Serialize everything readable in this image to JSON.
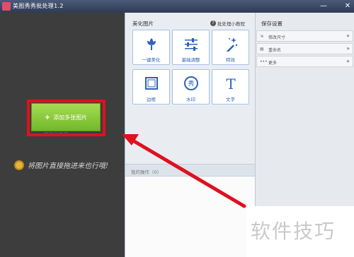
{
  "window": {
    "title": "美图秀秀批处理1.2",
    "minimize": "—",
    "close": "✕"
  },
  "left": {
    "add_button": "添加多张图片",
    "add_plus": "+",
    "under_text": "添加文件夹",
    "hint": "将图片直接拖进来也行哦!"
  },
  "beautify": {
    "title": "美化图片",
    "tutorial": "批处理小教程",
    "tutorial_icon": "?",
    "tools": [
      {
        "label": "一键美化",
        "icon": "flower-icon"
      },
      {
        "label": "基础调整",
        "icon": "sliders-icon"
      },
      {
        "label": "特效",
        "icon": "magic-wand-icon"
      },
      {
        "label": "边框",
        "icon": "frame-icon"
      },
      {
        "label": "水印",
        "icon": "watermark-icon",
        "glyph": "秀"
      },
      {
        "label": "文字",
        "icon": "text-icon",
        "glyph": "T"
      }
    ]
  },
  "ops": {
    "label": "我的操作（0）"
  },
  "save": {
    "title": "保存设置",
    "rows": [
      {
        "label": "修改尺寸",
        "chevron": "»",
        "icon": "resize-icon"
      },
      {
        "label": "重命名",
        "chevron": "»",
        "icon": "rename-icon"
      },
      {
        "label": "更多",
        "chevron": "»",
        "icon": "more-icon"
      }
    ]
  },
  "watermark": "软件技巧",
  "colors": {
    "accent_green": "#8cc63f",
    "highlight_red": "#e0101e",
    "tool_blue": "#2e63b8"
  }
}
